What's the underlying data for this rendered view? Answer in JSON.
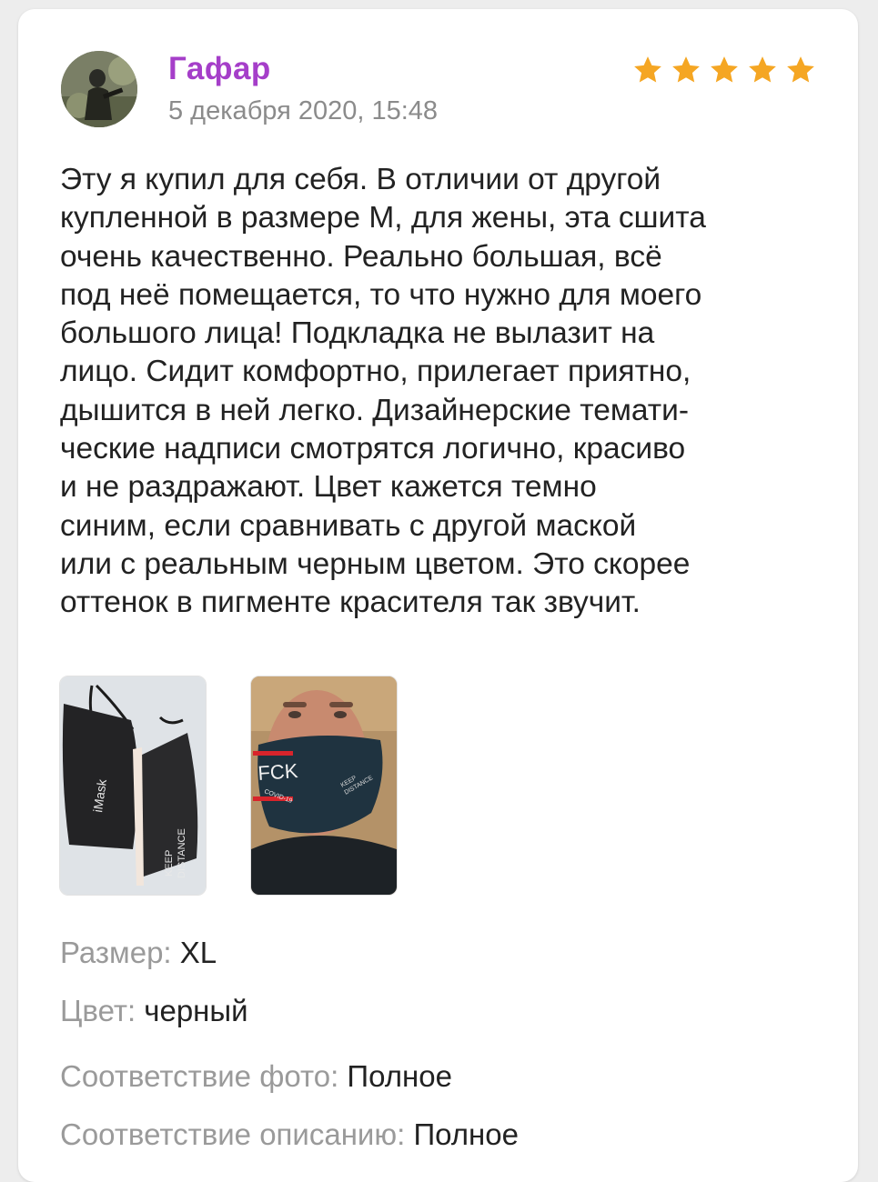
{
  "review": {
    "author": "Гафар",
    "date": "5 декабря 2020, 15:48",
    "rating": 5,
    "rating_max": 5,
    "star_color": "#f5a623",
    "author_color": "#a53ec9",
    "text": "Эту я купил для себя. В отличии от другой\nкупленной в размере М, для жены, эта сшита\nочень качественно. Реально большая, всё\nпод неё помещается, то что нужно для моего\nбольшого лица! Подкладка не вылазит на\nлицо. Сидит комфортно, прилегает приятно,\nдышится в ней легко. Дизайнерские темати-\nческие надписи смотрятся логично, красиво\nи не раздражают. Цвет кажется темно\nсиним, если сравнивать с другой маской\nили с реальным черным цветом. Это скорее\nоттенок в пигменте красителя так звучит.",
    "photos": [
      {
        "icon": "masks-photo",
        "printed_text": [
          "iMask",
          "KEEP",
          "DISTANCE"
        ]
      },
      {
        "icon": "man-in-mask-photo",
        "printed_text": [
          "FCK",
          "COVID-19",
          "KEEP",
          "DISTANCE"
        ]
      }
    ],
    "properties": [
      {
        "label": "Размер: ",
        "value": "XL"
      },
      {
        "label": "Цвет: ",
        "value": "черный"
      },
      {
        "label": "Соответствие фото: ",
        "value": "Полное"
      },
      {
        "label": "Соответствие описанию: ",
        "value": "Полное"
      }
    ]
  }
}
